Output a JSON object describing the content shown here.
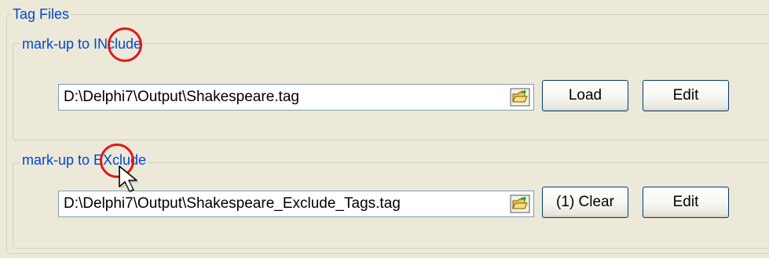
{
  "tag_files": {
    "title": "Tag Files",
    "include": {
      "title": "mark-up to INclude",
      "path": "D:\\Delphi7\\Output\\Shakespeare.tag",
      "load_label": "Load",
      "edit_label": "Edit"
    },
    "exclude": {
      "title": "mark-up to EXclude",
      "path": "D:\\Delphi7\\Output\\Shakespeare_Exclude_Tags.tag",
      "clear_label": "(1) Clear",
      "edit_label": "Edit"
    }
  },
  "colors": {
    "panel": "#ece9d8",
    "group_title": "#0046d5",
    "highlight": "#e01818",
    "button_border": "#003c74"
  },
  "icons": {
    "browse": "folder-open-icon",
    "highlight": "red-circle-highlight",
    "cursor": "arrow-cursor-icon"
  }
}
